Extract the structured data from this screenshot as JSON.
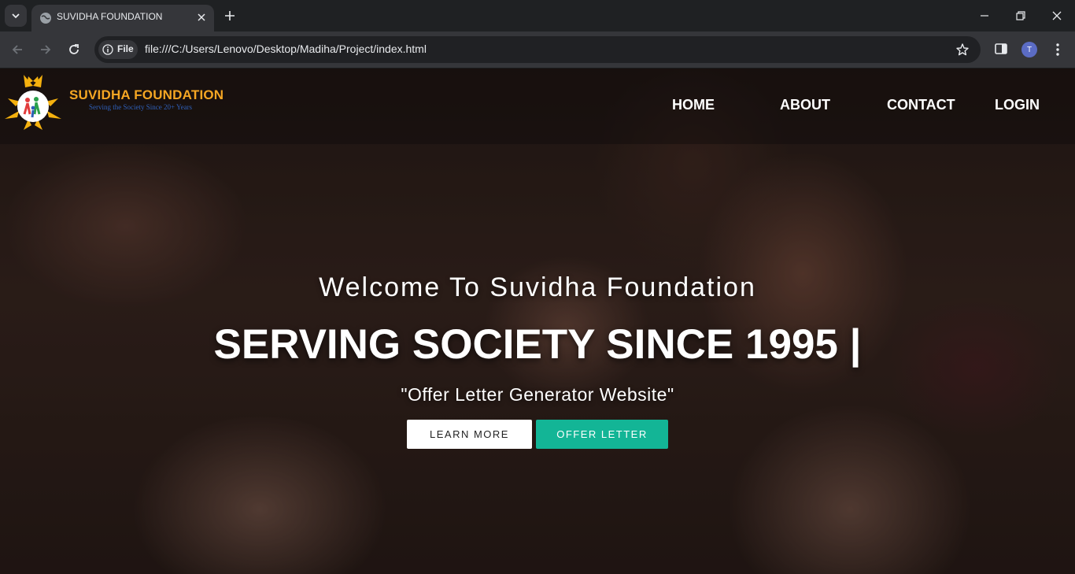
{
  "browser": {
    "tab": {
      "title": "SUVIDHA FOUNDATION"
    },
    "omnibox": {
      "chip_label": "File",
      "url": "file:///C:/Users/Lenovo/Desktop/Madiha/Project/index.html"
    },
    "profile_initial": "T",
    "icons": [
      "tab-search-icon",
      "globe-icon",
      "close-icon",
      "plus-icon",
      "minimize-icon",
      "maximize-icon",
      "window-close-icon",
      "back-icon",
      "forward-icon",
      "reload-icon",
      "info-icon",
      "star-icon",
      "side-panel-icon",
      "kebab-menu-icon"
    ]
  },
  "site": {
    "brand": {
      "name": "SUVIDHA FOUNDATION",
      "tagline": "Serving the Society Since 20+ Years"
    },
    "nav": [
      {
        "label": "HOME"
      },
      {
        "label": "ABOUT"
      },
      {
        "label": "CONTACT"
      },
      {
        "label": "LOGIN"
      }
    ],
    "hero": {
      "welcome": "Welcome To Suvidha Foundation",
      "heading": "SERVING SOCIETY SINCE 1995 |",
      "subtitle": "\"Offer Letter Generator Website\"",
      "buttons": [
        {
          "label": "LEARN MORE"
        },
        {
          "label": "OFFER LETTER"
        }
      ]
    },
    "colors": {
      "brand_orange": "#f5a623",
      "tagline_blue": "#2f5fb8",
      "offer_button": "#13b596"
    }
  }
}
